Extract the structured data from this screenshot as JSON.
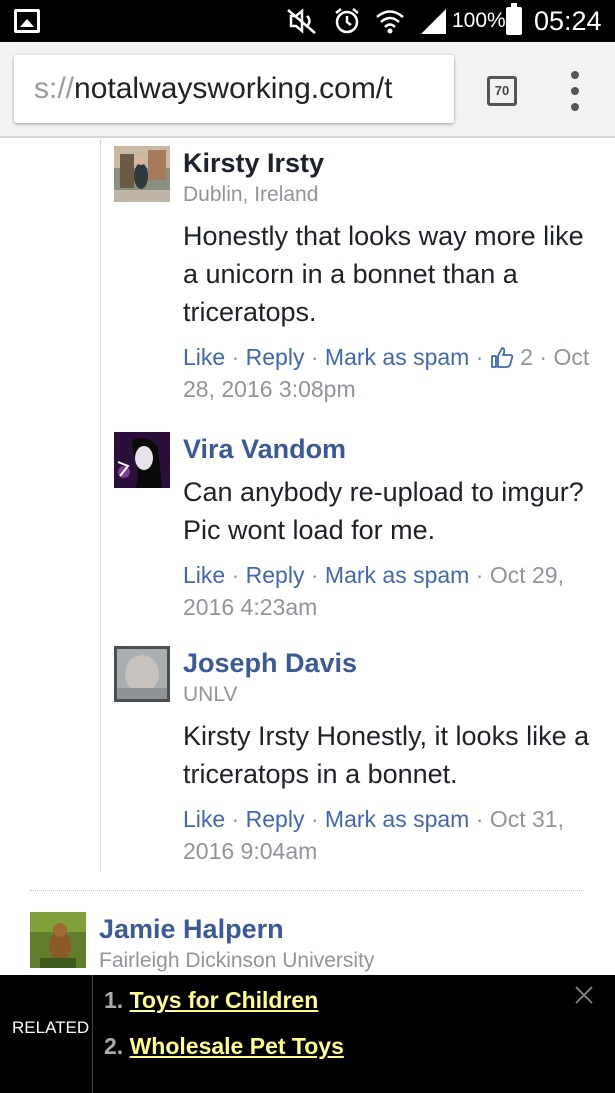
{
  "status_bar": {
    "icons": [
      "gallery-notification-icon",
      "mute-icon",
      "alarm-icon",
      "wifi-icon",
      "signal-icon",
      "battery-icon"
    ],
    "battery_percent": "100%",
    "time": "05:24"
  },
  "browser": {
    "url_scheme": "s://",
    "url_rest": "notalwaysworking.com/t",
    "tab_count": "70",
    "menu_icon": "more-vert-icon"
  },
  "comments": [
    {
      "author": "Kirsty Irsty",
      "author_linked": false,
      "affiliation": "Dublin, Ireland",
      "text": "Honestly that looks way more like a unicorn in a bonnet than a triceratops.",
      "actions": {
        "like": "Like",
        "reply": "Reply",
        "spam": "Mark as spam"
      },
      "like_count": "2",
      "timestamp": "Oct 28, 2016 3:08pm"
    },
    {
      "author": "Vira Vandom",
      "author_linked": true,
      "affiliation": "",
      "text": "Can anybody re-upload to imgur? Pic wont load for me.",
      "actions": {
        "like": "Like",
        "reply": "Reply",
        "spam": "Mark as spam"
      },
      "like_count": "",
      "timestamp": "Oct 29, 2016 4:23am"
    },
    {
      "author": "Joseph Davis",
      "author_linked": true,
      "affiliation": "UNLV",
      "text": "Kirsty Irsty Honestly, it looks like a triceratops in a bonnet.",
      "actions": {
        "like": "Like",
        "reply": "Reply",
        "spam": "Mark as spam"
      },
      "like_count": "",
      "timestamp": "Oct 31, 2016 9:04am"
    },
    {
      "author": "Jamie Halpern",
      "author_linked": true,
      "affiliation": "Fairleigh Dickinson University"
    }
  ],
  "separator_char": "·",
  "related": {
    "label": "RELATED",
    "items": [
      {
        "num": "1.",
        "title": "Toys for Children"
      },
      {
        "num": "2.",
        "title": "Wholesale Pet Toys"
      }
    ]
  },
  "colors": {
    "link_blue": "#3b5998",
    "action_blue": "#4267b2",
    "meta_gray": "#90949c",
    "related_link": "#ffff8a"
  }
}
